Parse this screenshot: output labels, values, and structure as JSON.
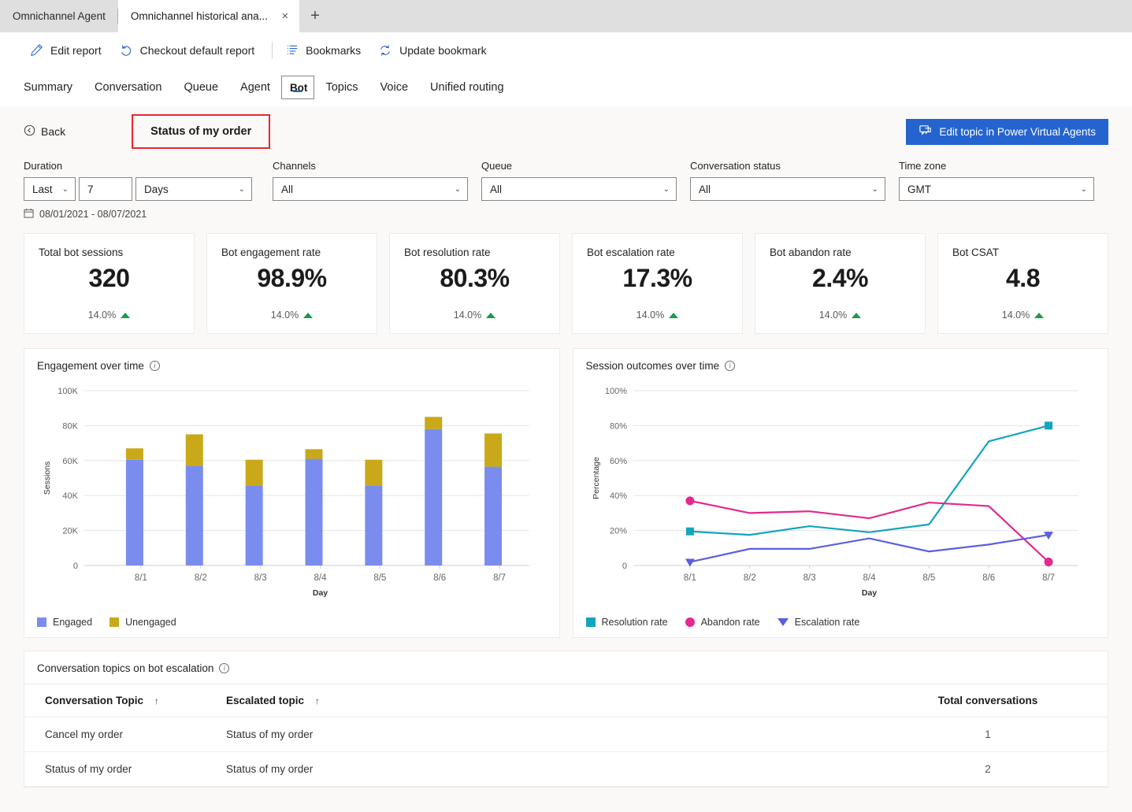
{
  "browser": {
    "tabs": [
      {
        "title": "Omnichannel Agent",
        "active": false
      },
      {
        "title": "Omnichannel historical ana...",
        "active": true
      }
    ],
    "close_glyph": "×",
    "newtab_glyph": "+"
  },
  "command_bar": {
    "items": [
      {
        "label": "Edit report",
        "icon": "pencil-icon"
      },
      {
        "label": "Checkout default report",
        "icon": "undo-icon"
      },
      {
        "label": "Bookmarks",
        "icon": "bookmarks-list-icon"
      },
      {
        "label": "Update bookmark",
        "icon": "refresh-icon"
      }
    ]
  },
  "nav_tabs": {
    "items": [
      "Summary",
      "Conversation",
      "Queue",
      "Agent",
      "Bot",
      "Topics",
      "Voice",
      "Unified routing"
    ],
    "selected": "Bot"
  },
  "header": {
    "back_label": "Back",
    "back_icon": "back-circle-icon",
    "topic_title": "Status of my order",
    "edit_button_label": "Edit topic in Power Virtual Agents",
    "edit_button_icon": "chat-bot-icon",
    "edit_button_color": "#2564cf",
    "highlight_color": "#e8272c"
  },
  "filters": {
    "duration": {
      "label": "Duration",
      "range_value": "Last",
      "count_value": "7",
      "unit_value": "Days"
    },
    "channels": {
      "label": "Channels",
      "value": "All"
    },
    "queue": {
      "label": "Queue",
      "value": "All"
    },
    "conversation_status": {
      "label": "Conversation status",
      "value": "All"
    },
    "time_zone": {
      "label": "Time zone",
      "value": "GMT"
    },
    "date_range": "08/01/2021 - 08/07/2021",
    "calendar_icon": "calendar-icon",
    "chevron": "⌄"
  },
  "kpis": [
    {
      "title": "Total bot sessions",
      "value": "320",
      "delta": "14.0%",
      "trend": "up"
    },
    {
      "title": "Bot engagement rate",
      "value": "98.9%",
      "delta": "14.0%",
      "trend": "up"
    },
    {
      "title": "Bot resolution rate",
      "value": "80.3%",
      "delta": "14.0%",
      "trend": "up"
    },
    {
      "title": "Bot escalation rate",
      "value": "17.3%",
      "delta": "14.0%",
      "trend": "up"
    },
    {
      "title": "Bot abandon rate",
      "value": "2.4%",
      "delta": "14.0%",
      "trend": "up"
    },
    {
      "title": "Bot CSAT",
      "value": "4.8",
      "delta": "14.0%",
      "trend": "up"
    }
  ],
  "chart_data": [
    {
      "type": "bar",
      "title": "Engagement over time",
      "stacked": true,
      "categories": [
        "8/1",
        "8/2",
        "8/3",
        "8/4",
        "8/5",
        "8/6",
        "8/7"
      ],
      "series": [
        {
          "name": "Engaged",
          "color": "#7a8dee",
          "values": [
            60500,
            57000,
            45500,
            61000,
            45500,
            78000,
            56500
          ]
        },
        {
          "name": "Unengaged",
          "color": "#c9a91a",
          "values": [
            6500,
            18000,
            15000,
            5500,
            15000,
            7000,
            19000
          ]
        }
      ],
      "xlabel": "Day",
      "ylabel": "Sessions",
      "ylim": [
        0,
        100000
      ],
      "yticks": [
        0,
        20000,
        40000,
        60000,
        80000,
        100000
      ],
      "yticklabels": [
        "0",
        "20K",
        "40K",
        "60K",
        "80K",
        "100K"
      ],
      "grid": true,
      "legend_position": "bottom-left"
    },
    {
      "type": "line",
      "title": "Session outcomes over time",
      "categories": [
        "8/1",
        "8/2",
        "8/3",
        "8/4",
        "8/5",
        "8/6",
        "8/7"
      ],
      "series": [
        {
          "name": "Resolution rate",
          "color": "#13a5bd",
          "marker": "square",
          "values": [
            19.5,
            17.5,
            22.5,
            19.0,
            23.5,
            71.0,
            80.0
          ]
        },
        {
          "name": "Abandon rate",
          "color": "#e3288f",
          "marker": "circle",
          "values": [
            37.0,
            30.0,
            31.0,
            27.0,
            36.0,
            34.0,
            2.0
          ]
        },
        {
          "name": "Escalation rate",
          "color": "#5b5fe0",
          "marker": "triangle",
          "values": [
            2.0,
            9.5,
            9.5,
            15.5,
            8.0,
            12.0,
            17.5
          ]
        }
      ],
      "xlabel": "Day",
      "ylabel": "Percentage",
      "ylim": [
        0,
        100
      ],
      "yticks": [
        0,
        20,
        40,
        60,
        80,
        100
      ],
      "yticklabels": [
        "0",
        "20%",
        "40%",
        "60%",
        "80%",
        "100%"
      ],
      "grid": true,
      "legend_position": "bottom-left"
    }
  ],
  "table": {
    "title": "Conversation topics on bot escalation",
    "sort_glyph": "↑",
    "columns": [
      "Conversation Topic",
      "Escalated topic",
      "Total conversations"
    ],
    "rows": [
      {
        "topic": "Cancel my order",
        "escalated": "Status of my order",
        "total": "1"
      },
      {
        "topic": "Status of my order",
        "escalated": "Status of my order",
        "total": "2"
      }
    ]
  }
}
